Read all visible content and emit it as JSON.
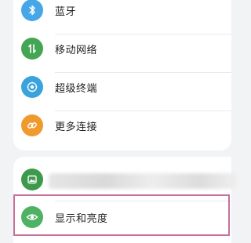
{
  "settings": {
    "items": [
      {
        "label": "蓝牙",
        "icon": "bluetooth-icon",
        "color": "#46a6e6"
      },
      {
        "label": "移动网络",
        "icon": "mobile-network-icon",
        "color": "#44a654"
      },
      {
        "label": "超级终端",
        "icon": "super-device-icon",
        "color": "#3aa3dc"
      },
      {
        "label": "更多连接",
        "icon": "link-icon",
        "color": "#f09a2e"
      }
    ],
    "obscured_item": {
      "icon": "gallery-icon",
      "color": "#3d9a4d"
    },
    "display_item": {
      "label": "显示和亮度",
      "icon": "eye-icon",
      "color": "#4eb163"
    }
  },
  "highlight_color": "#c7709a"
}
